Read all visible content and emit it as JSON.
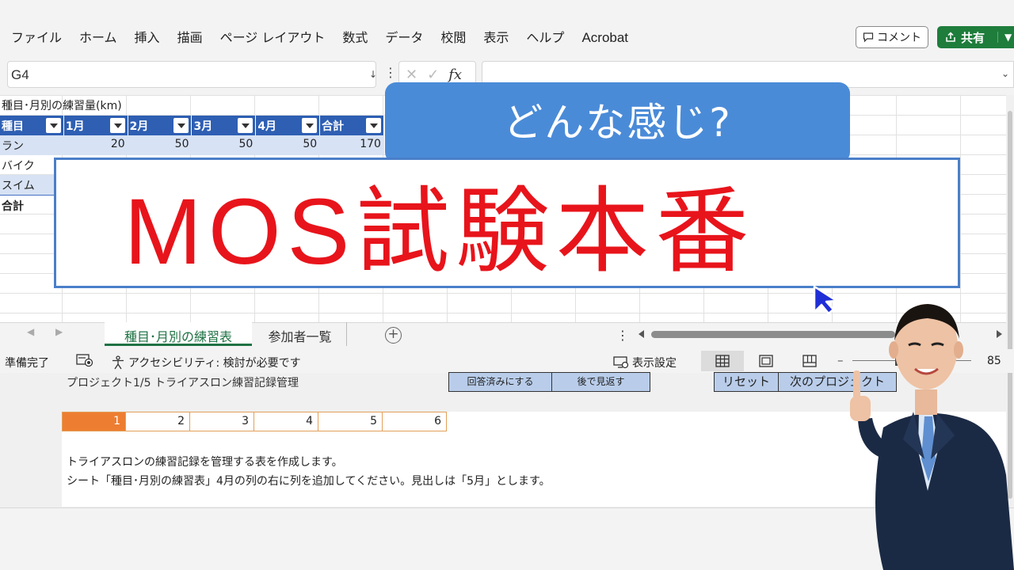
{
  "ribbon": {
    "tabs": [
      "ファイル",
      "ホーム",
      "挿入",
      "描画",
      "ページ レイアウト",
      "数式",
      "データ",
      "校閲",
      "表示",
      "ヘルプ",
      "Acrobat"
    ],
    "comment_label": "コメント",
    "share_label": "共有"
  },
  "formula_bar": {
    "name_box": "G4",
    "fx_label": "fx",
    "formula": ""
  },
  "sheet": {
    "title": "種目･月別の練習量(km)",
    "headers": [
      "種目",
      "1月",
      "2月",
      "3月",
      "4月",
      "合計"
    ],
    "rows": [
      {
        "label": "ラン",
        "values": [
          "20",
          "50",
          "50",
          "50",
          "170"
        ]
      },
      {
        "label": "バイク",
        "values": [
          "",
          "",
          "",
          "",
          ""
        ]
      },
      {
        "label": "スイム",
        "values": [
          "",
          "",
          "",
          "",
          ""
        ]
      },
      {
        "label": "合計",
        "values": [
          "",
          "",
          "",
          "",
          ""
        ]
      }
    ]
  },
  "overlay": {
    "bubble_text": "どんな感じ?",
    "title_text": "MOS試験本番",
    "title_color": "#e8141b",
    "bubble_color": "#4a8bd8"
  },
  "sheet_tabs": {
    "active": "種目･月別の練習表",
    "other": "参加者一覧"
  },
  "status": {
    "ready": "準備完了",
    "accessibility": "アクセシビリティ: 検討が必要です",
    "display_settings": "表示設定",
    "zoom": "85"
  },
  "task": {
    "project_title": "プロジェクト1/5 トライアスロン練習記録管理",
    "btn_answered": "回答済みにする",
    "btn_review": "後で見返す",
    "btn_reset": "リセット",
    "btn_next": "次のプロジェクト",
    "numbers": [
      "1",
      "2",
      "3",
      "4",
      "5",
      "6"
    ],
    "current": "1",
    "description_1": "トライアスロンの練習記録を管理する表を作成します。",
    "description_2": "シート「種目･月別の練習表」4月の列の右に列を追加してください。見出しは「5月」とします。"
  },
  "colors": {
    "accent_green": "#1e7d3b",
    "table_header": "#2e5fb3",
    "current_task": "#ed7d31"
  }
}
